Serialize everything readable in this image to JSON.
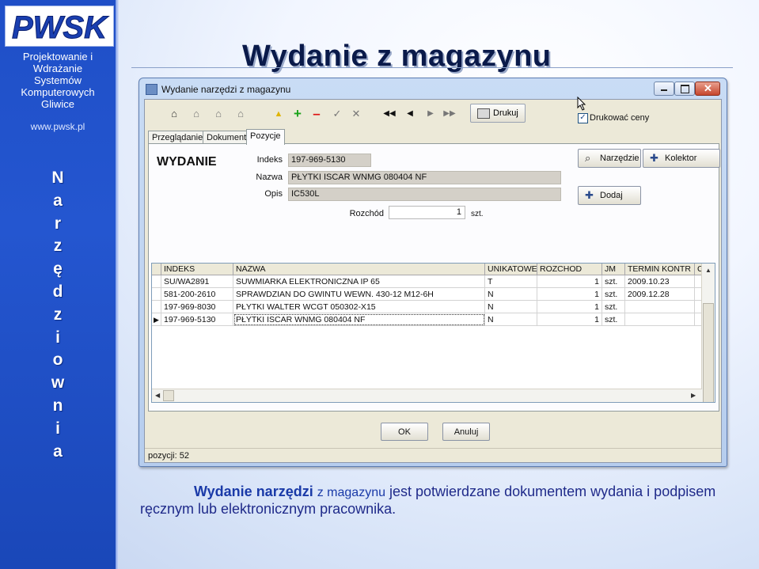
{
  "sidebar": {
    "logo_text": "PWSK",
    "school_lines": [
      "Projektowanie i",
      "Wdrażanie",
      "Systemów",
      "Komputerowych",
      "Gliwice"
    ],
    "url": "www.pwsk.pl",
    "vertical_word": [
      "N",
      "a",
      "r",
      "z",
      "ę",
      "d",
      "z",
      "i",
      "o",
      "w",
      "n",
      "i",
      "a"
    ]
  },
  "slide_title": "Wydanie z magazynu",
  "window": {
    "title": "Wydanie narzędzi z magazynu",
    "toolbar": {
      "print_label": "Drukuj",
      "print_prices_label": "Drukować ceny",
      "print_prices_checked": true
    },
    "tabs": [
      "Przeglądanie",
      "Dokument",
      "Pozycje"
    ],
    "active_tab": "Pozycje",
    "heading": "WYDANIE",
    "fields": {
      "indeks_label": "Indeks",
      "indeks_value": "197-969-5130",
      "nazwa_label": "Nazwa",
      "nazwa_value": "PŁYTKI ISCAR WNMG 080404 NF",
      "opis_label": "Opis",
      "opis_value": "IC530L",
      "rozchod_label": "Rozchód",
      "rozchod_value": "1",
      "rozchod_unit": "szt."
    },
    "buttons": {
      "narzedzie": "Narzędzie",
      "kolektor": "Kolektor",
      "dodaj": "Dodaj",
      "ok": "OK",
      "anuluj": "Anuluj"
    },
    "grid": {
      "columns": [
        "INDEKS",
        "NAZWA",
        "UNIKATOWE",
        "ROZCHOD",
        "JM",
        "TERMIN KONTR",
        "Cen"
      ],
      "rows": [
        [
          "SU/WA2891",
          "SUWMIARKA ELEKTRONICZNA IP 65",
          "T",
          "1",
          "szt.",
          "2009.10.23"
        ],
        [
          "581-200-2610",
          "SPRAWDZIAN DO GWINTU WEWN. 430-12 M12-6H",
          "N",
          "1",
          "szt.",
          "2009.12.28"
        ],
        [
          "197-969-8030",
          "PŁYTKI WALTER WCGT 050302-X15",
          "N",
          "1",
          "szt.",
          ""
        ],
        [
          "197-969-5130",
          "PŁYTKI ISCAR WNMG 080404 NF",
          "N",
          "1",
          "szt.",
          ""
        ]
      ],
      "current_row": 3
    },
    "status": "pozycji:  52"
  },
  "caption": {
    "bold_part": "Wydanie narzędzi",
    "mid_part": "z magazynu",
    "rest": " jest potwierdzane dokumentem wydania i podpisem ręcznym lub elektronicznym pracownika."
  },
  "colors": {
    "sidebar": "#2456d0",
    "title": "#0a1a4a",
    "caption": "#1f2a8a",
    "window_frame": "#b6cdee"
  }
}
